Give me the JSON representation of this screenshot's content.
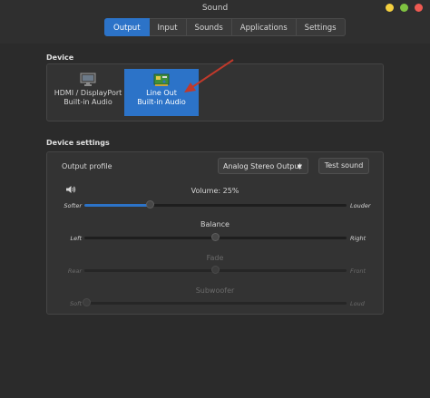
{
  "window": {
    "title": "Sound"
  },
  "tabs": [
    {
      "label": "Output",
      "active": true
    },
    {
      "label": "Input",
      "active": false
    },
    {
      "label": "Sounds",
      "active": false
    },
    {
      "label": "Applications",
      "active": false
    },
    {
      "label": "Settings",
      "active": false
    }
  ],
  "device_section": {
    "label": "Device",
    "devices": [
      {
        "line1": "HDMI / DisplayPort",
        "line2": "Built-in Audio",
        "icon": "monitor-icon",
        "selected": false
      },
      {
        "line1": "Line Out",
        "line2": "Built-in Audio",
        "icon": "sound-card-icon",
        "selected": true
      }
    ]
  },
  "settings_section": {
    "label": "Device settings",
    "output_profile_label": "Output profile",
    "output_profile_value": "Analog Stereo Output",
    "test_button": "Test sound",
    "volume": {
      "title": "Volume: 25%",
      "min_label": "Softer",
      "max_label": "Louder",
      "value_percent": 25
    },
    "balance": {
      "title": "Balance",
      "min_label": "Left",
      "max_label": "Right",
      "value_fraction": 0.5
    },
    "fade": {
      "title": "Fade",
      "min_label": "Rear",
      "max_label": "Front",
      "value_fraction": 0.5
    },
    "subwoofer": {
      "title": "Subwoofer",
      "min_label": "Soft",
      "max_label": "Loud",
      "value_fraction": 0.0
    }
  },
  "colors": {
    "accent": "#2c73c8",
    "background": "#2b2b2b",
    "annotation_arrow": "#c0392b"
  }
}
